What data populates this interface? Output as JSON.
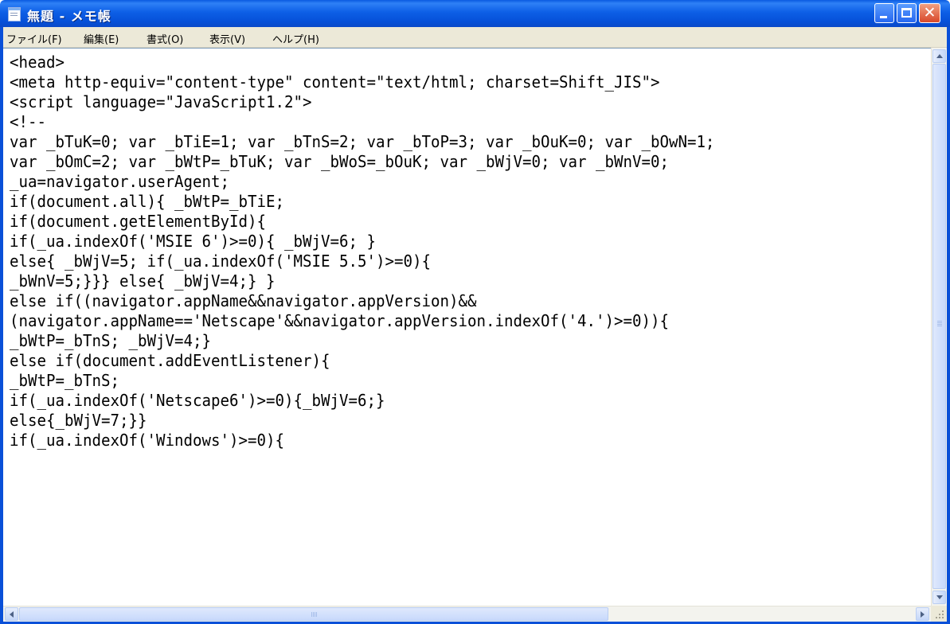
{
  "window": {
    "title": "無題 - メモ帳",
    "icon": "notepad-icon",
    "accent_color": "#0a50d8"
  },
  "menu": {
    "items": [
      {
        "label": "ファイル(F)"
      },
      {
        "label": "編集(E)"
      },
      {
        "label": "書式(O)"
      },
      {
        "label": "表示(V)"
      },
      {
        "label": "ヘルプ(H)"
      }
    ]
  },
  "editor": {
    "lines": [
      "<head>",
      "<meta http-equiv=\"content-type\" content=\"text/html; charset=Shift_JIS\">",
      "<script language=\"JavaScript1.2\">",
      "<!--",
      "var _bTuK=0; var _bTiE=1; var _bTnS=2; var _bToP=3; var _bOuK=0; var _bOwN=1;",
      "var _bOmC=2; var _bWtP=_bTuK; var _bWoS=_bOuK; var _bWjV=0; var _bWnV=0;",
      "_ua=navigator.userAgent;",
      "if(document.all){ _bWtP=_bTiE;",
      "if(document.getElementById){",
      "if(_ua.indexOf('MSIE 6')>=0){ _bWjV=6; }",
      "else{ _bWjV=5; if(_ua.indexOf('MSIE 5.5')>=0){",
      "_bWnV=5;}}} else{ _bWjV=4;} }",
      "else if((navigator.appName&&navigator.appVersion)&&",
      "(navigator.appName=='Netscape'&&navigator.appVersion.indexOf('4.')>=0)){",
      "_bWtP=_bTnS; _bWjV=4;}",
      "else if(document.addEventListener){",
      "_bWtP=_bTnS;",
      "if(_ua.indexOf('Netscape6')>=0){_bWjV=6;}",
      "else{_bWjV=7;}}",
      "if(_ua.indexOf('Windows')>=0){"
    ]
  }
}
